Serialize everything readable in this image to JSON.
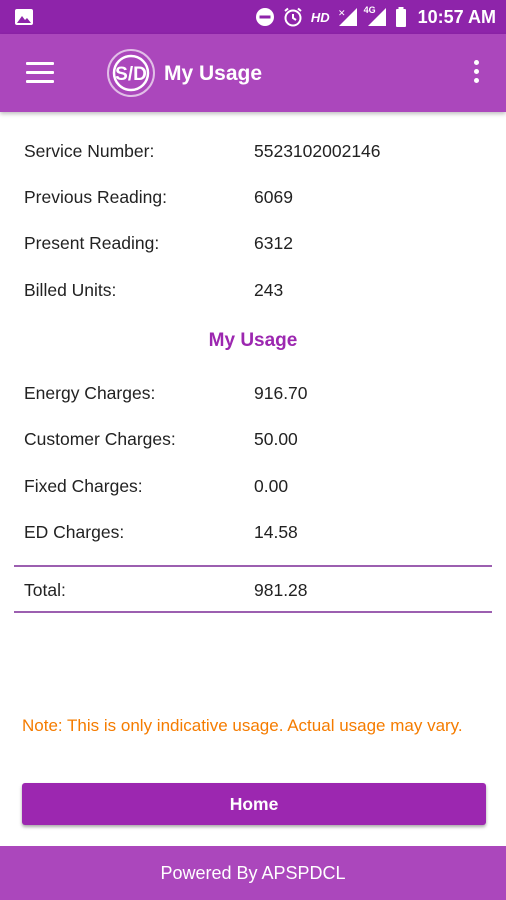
{
  "status_bar": {
    "hd_label": "HD",
    "network_label": "4G",
    "time": "10:57 AM"
  },
  "app_bar": {
    "title": "My Usage",
    "logo_text": "S/D"
  },
  "details": [
    {
      "label": "Service Number:",
      "value": "5523102002146"
    },
    {
      "label": "Previous Reading:",
      "value": "6069"
    },
    {
      "label": "Present Reading:",
      "value": "6312"
    },
    {
      "label": "Billed Units:",
      "value": "243"
    }
  ],
  "usage_section": {
    "title": "My Usage",
    "charges": [
      {
        "label": "Energy Charges:",
        "value": "916.70"
      },
      {
        "label": "Customer Charges:",
        "value": "50.00"
      },
      {
        "label": "Fixed Charges:",
        "value": "0.00"
      },
      {
        "label": "ED Charges:",
        "value": "14.58"
      }
    ],
    "total": {
      "label": "Total:",
      "value": "981.28"
    }
  },
  "note": "Note: This is only indicative usage. Actual usage may vary.",
  "home_button_label": "Home",
  "footer": "Powered By APSPDCL",
  "colors": {
    "status_bar": "#8e24aa",
    "app_bar": "#ab47bc",
    "accent": "#9c27b0",
    "note": "#f57c00"
  }
}
